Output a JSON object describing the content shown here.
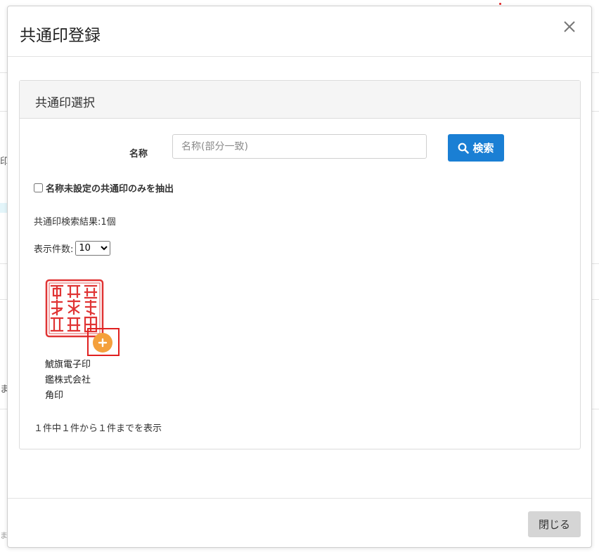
{
  "background": {
    "fragments": [
      "印",
      "ま",
      "ま"
    ]
  },
  "modal": {
    "title": "共通印登録",
    "close_icon": "close-icon",
    "panel_title": "共通印選択",
    "search": {
      "label": "名称",
      "placeholder": "名称(部分一致)",
      "value": "",
      "button_label": "検索",
      "button_icon": "search-icon",
      "button_color": "#1a7fd4"
    },
    "filter": {
      "label": "名称未設定の共通印のみを抽出",
      "checked": false
    },
    "result_count": "共通印検索結果:1個",
    "page_size": {
      "label": "表示件数:",
      "selected": "10"
    },
    "seals": [
      {
        "image_icon": "seal-stamp-icon",
        "add_icon": "plus-icon",
        "name_lines": [
          "鯱旗電子印",
          "鑑株式会社",
          "角印"
        ],
        "seal_color": "#e03434",
        "add_color": "#f4a03c"
      }
    ],
    "pager_info": "１件中１件から１件までを表示",
    "footer_close_label": "閉じる"
  }
}
